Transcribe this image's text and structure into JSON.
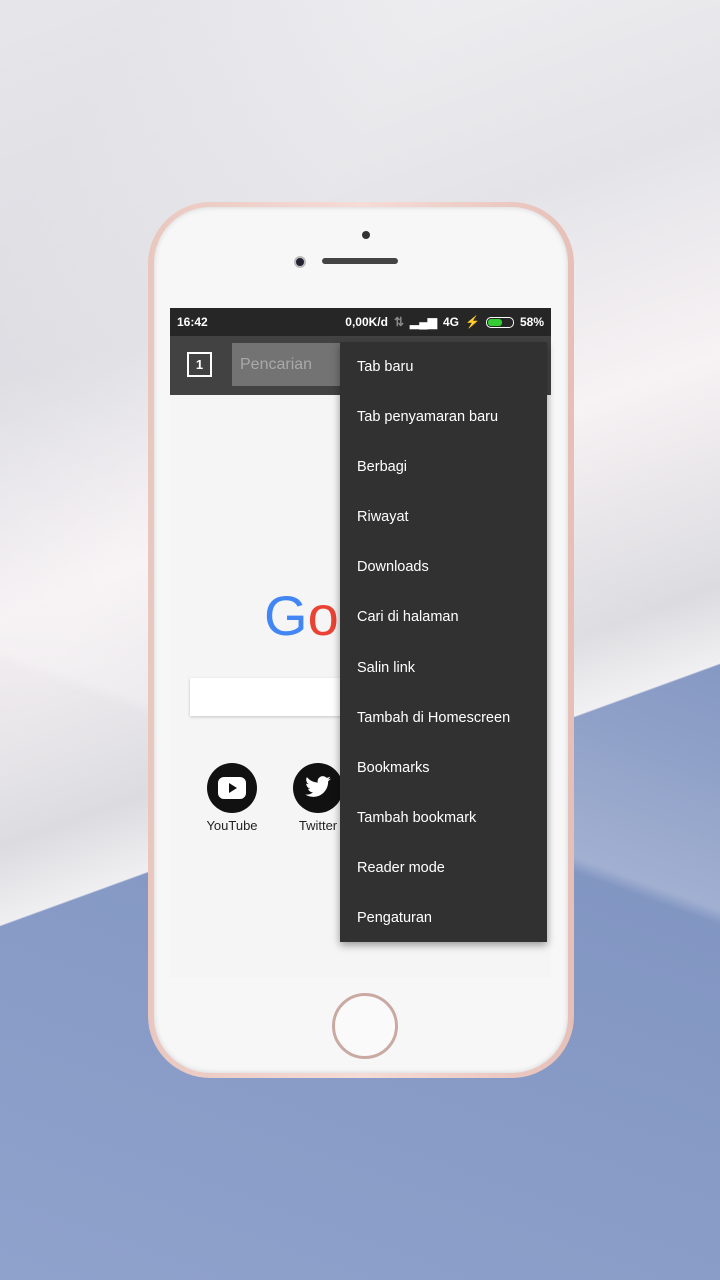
{
  "status": {
    "time": "16:42",
    "speed": "0,00K/d",
    "network": "4G",
    "battery": "58%",
    "battery_level": 0.58
  },
  "toolbar": {
    "tab_count": "1",
    "search_placeholder": "Pencarian"
  },
  "logo": {
    "text": "Go"
  },
  "shortcuts": [
    {
      "label": "YouTube",
      "icon": "youtube-icon"
    },
    {
      "label": "Twitter",
      "icon": "twitter-icon"
    }
  ],
  "menu": {
    "items": [
      "Tab baru",
      "Tab penyamaran baru",
      "Berbagi",
      "Riwayat",
      "Downloads",
      "Cari di halaman",
      "Salin link",
      "Tambah di Homescreen",
      "Bookmarks",
      "Tambah bookmark",
      "Reader mode",
      "Pengaturan"
    ]
  },
  "colors": {
    "toolbar": "#424242",
    "menu": "#313131",
    "google_blue": "#4285F4",
    "google_red": "#EA4335"
  }
}
